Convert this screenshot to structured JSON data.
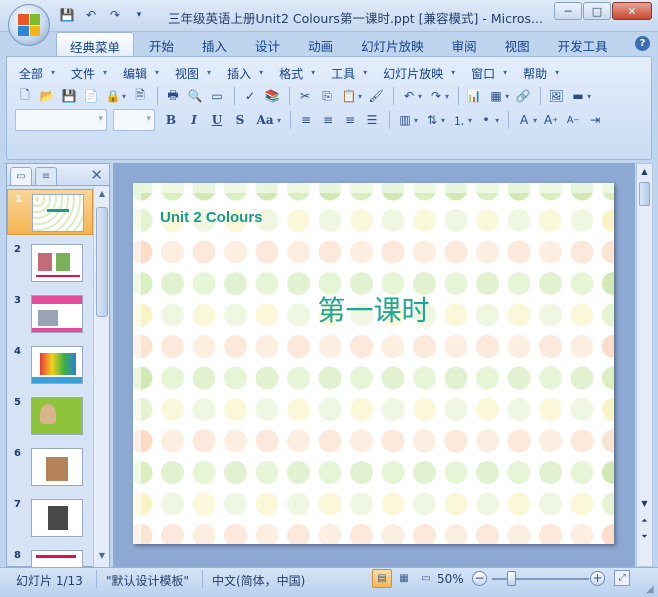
{
  "window": {
    "title": "三年级英语上册Unit2 Colours第一课时.ppt [兼容模式] - Micros...",
    "minimize": "─",
    "maximize": "□",
    "close": "✕"
  },
  "quick_access": {
    "icons": [
      "save-icon",
      "undo-icon",
      "redo-icon",
      "customize-icon"
    ]
  },
  "ribbon_tabs": [
    "经典菜单",
    "开始",
    "插入",
    "设计",
    "动画",
    "幻灯片放映",
    "审阅",
    "视图",
    "开发工具"
  ],
  "active_tab_index": 0,
  "help_label": "?",
  "classic_menus": [
    "全部",
    "文件",
    "编辑",
    "视图",
    "插入",
    "格式",
    "工具",
    "幻灯片放映",
    "窗口",
    "帮助"
  ],
  "toolbar_row1": [
    {
      "name": "new-icon",
      "glyph": "🗋"
    },
    {
      "name": "open-icon",
      "glyph": "📂"
    },
    {
      "name": "save-icon",
      "glyph": "💾"
    },
    {
      "name": "save-as-pdf-icon",
      "glyph": "📄"
    },
    {
      "name": "permission-icon",
      "glyph": "🔒"
    },
    {
      "name": "print-preview-icon",
      "glyph": "🗎"
    },
    {
      "name": "print-icon",
      "glyph": "🖶"
    },
    {
      "name": "preview-icon",
      "glyph": "🔍"
    },
    {
      "name": "research-icon",
      "glyph": "▭"
    },
    {
      "name": "spelling-icon",
      "glyph": "✓"
    },
    {
      "name": "reference-icon",
      "glyph": "📚"
    },
    {
      "name": "cut-icon",
      "glyph": "✂"
    },
    {
      "name": "copy-icon",
      "glyph": "⎘"
    },
    {
      "name": "paste-icon",
      "glyph": "📋"
    },
    {
      "name": "format-painter-icon",
      "glyph": "🖌"
    },
    {
      "name": "undo-icon",
      "glyph": "↶"
    },
    {
      "name": "redo-icon",
      "glyph": "↷"
    },
    {
      "name": "chart-icon",
      "glyph": "📊"
    },
    {
      "name": "table-icon",
      "glyph": "▦"
    },
    {
      "name": "hyperlink-icon",
      "glyph": "🔗"
    },
    {
      "name": "picture-icon",
      "glyph": "🖼"
    },
    {
      "name": "color-icon",
      "glyph": "▬"
    }
  ],
  "font_combo": {
    "value": ""
  },
  "size_combo": {
    "value": ""
  },
  "format_buttons": [
    "B",
    "I",
    "U",
    "S",
    "Aa"
  ],
  "panel": {
    "tab_slides_icon": "slides-tab-icon",
    "tab_outline_icon": "outline-tab-icon",
    "close": "✕",
    "slides": [
      "1",
      "2",
      "3",
      "4",
      "5",
      "6",
      "7",
      "8"
    ],
    "selected_index": 0
  },
  "slide": {
    "subtitle": "Unit 2  Colours",
    "title": "第一课时"
  },
  "status": {
    "slide_info": "幻灯片 1/13",
    "theme": "\"默认设计模板\"",
    "language": "中文(简体，中国)",
    "zoom": "50%",
    "zoom_minus": "−",
    "zoom_plus": "+",
    "zoom_level": 0.5
  },
  "colors": {
    "accent_teal": "#1c9a8e",
    "ribbon_blue": "#15428b",
    "selected_orange": "#f4b350"
  }
}
